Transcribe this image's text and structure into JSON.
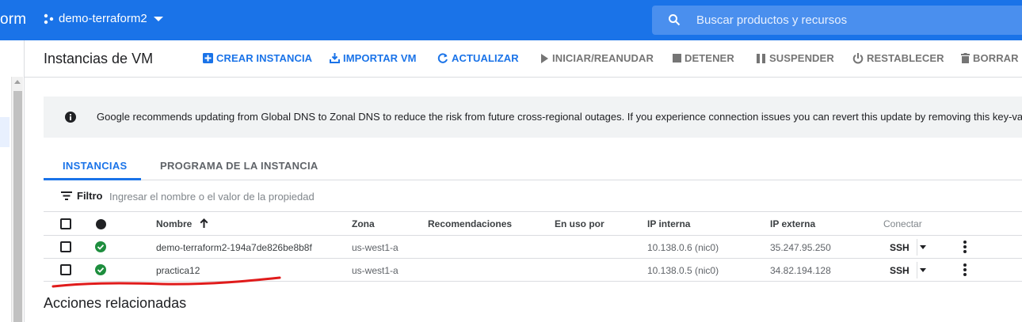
{
  "topbar": {
    "brand_fragment": "orm",
    "project_name": "demo-terraform2",
    "search_placeholder": "Buscar productos y recursos"
  },
  "actionbar": {
    "title": "Instancias de VM",
    "create": "CREAR INSTANCIA",
    "import": "IMPORTAR VM",
    "refresh": "ACTUALIZAR",
    "start": "INICIAR/REANUDAR",
    "stop": "DETENER",
    "suspend": "SUSPENDER",
    "reset": "RESTABLECER",
    "delete": "BORRAR"
  },
  "banner": {
    "message": "Google recommends updating from Global DNS to Zonal DNS to reduce the risk from future cross-regional outages. If you experience connection issues you can revert this update by removing this key-valu"
  },
  "tabs": [
    {
      "label": "INSTANCIAS",
      "active": true
    },
    {
      "label": "PROGRAMA DE LA INSTANCIA",
      "active": false
    }
  ],
  "filter": {
    "label": "Filtro",
    "placeholder": "Ingresar el nombre o el valor de la propiedad"
  },
  "table": {
    "headers": {
      "name": "Nombre",
      "zone": "Zona",
      "recommendations": "Recomendaciones",
      "in_use_by": "En uso por",
      "internal_ip": "IP interna",
      "external_ip": "IP externa",
      "connect": "Conectar"
    },
    "rows": [
      {
        "name": "demo-terraform2-194a7de826be8b8f",
        "zone": "us-west1-a",
        "internal_ip": "10.138.0.6",
        "nic": "nic0",
        "external_ip": "35.247.95.250",
        "connect": "SSH",
        "status": "running"
      },
      {
        "name": "practica12",
        "zone": "us-west1-a",
        "internal_ip": "10.138.0.5",
        "nic": "nic0",
        "external_ip": "34.82.194.128",
        "connect": "SSH",
        "status": "running"
      }
    ]
  },
  "related": {
    "title": "Acciones relacionadas"
  },
  "colors": {
    "brand_blue": "#1a73e8",
    "status_ok": "#1e8e3e",
    "annotation_red": "#e01b1b"
  }
}
